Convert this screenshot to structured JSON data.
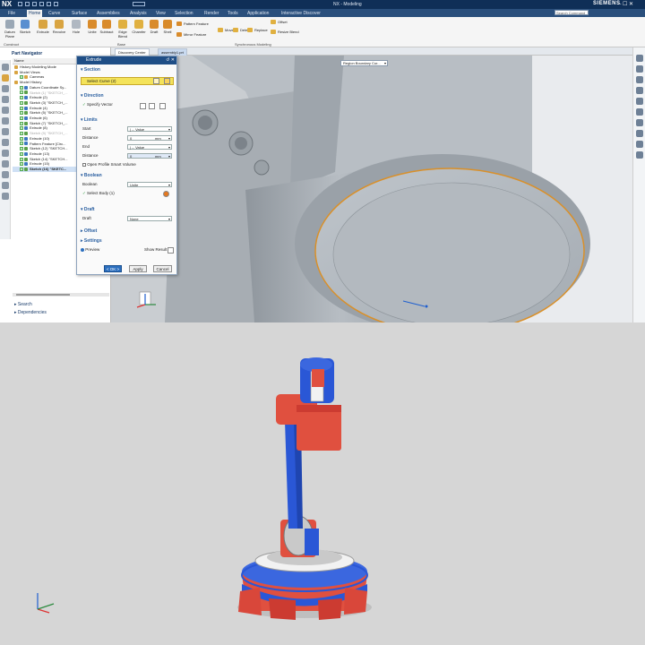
{
  "titlebar": {
    "app_logo": "NX",
    "window_title": "NX - Modeling",
    "brand": "SIEMENS",
    "controls": "– ☐ ✕"
  },
  "menu": {
    "tabs": [
      "File",
      "Home",
      "Curve",
      "Surface",
      "Assemblies",
      "Analysis",
      "View",
      "Selection",
      "Render",
      "Tools",
      "Application",
      "Interactive Discover"
    ],
    "active_index": 1,
    "search_placeholder": "Search Command"
  },
  "ribbon": {
    "buttons": [
      {
        "label": "Datum Plane",
        "icon": "datum-plane-icon",
        "color": "#9aa7b5"
      },
      {
        "label": "Sketch",
        "icon": "sketch-icon",
        "color": "#5a8fd0"
      },
      {
        "label": "Extrude",
        "icon": "extrude-icon",
        "color": "#d9a441"
      },
      {
        "label": "Revolve",
        "icon": "revolve-icon",
        "color": "#d9a441"
      },
      {
        "label": "Hole",
        "icon": "hole-icon",
        "color": "#b0b8c2"
      },
      {
        "label": "Unite",
        "icon": "unite-icon",
        "color": "#d98b2b"
      },
      {
        "label": "Subtract",
        "icon": "subtract-icon",
        "color": "#d98b2b"
      },
      {
        "label": "Edge Blend",
        "icon": "edge-blend-icon",
        "color": "#e0b040"
      },
      {
        "label": "Chamfer",
        "icon": "chamfer-icon",
        "color": "#e0b040"
      },
      {
        "label": "Draft",
        "icon": "draft-icon",
        "color": "#d98b2b"
      },
      {
        "label": "Shell",
        "icon": "shell-icon",
        "color": "#d98b2b"
      }
    ],
    "small_left": [
      {
        "label": "Pattern Feature",
        "icon": "pattern-feature-icon"
      },
      {
        "label": "Mirror Feature",
        "icon": "mirror-feature-icon"
      }
    ],
    "small_right": [
      {
        "label": "Move",
        "icon": "move-face-icon"
      },
      {
        "label": "Delete",
        "icon": "delete-face-icon"
      },
      {
        "label": "Replace",
        "icon": "replace-face-icon"
      },
      {
        "label": "Offset",
        "icon": "offset-face-icon"
      },
      {
        "label": "Resize Blend",
        "icon": "resize-blend-icon"
      }
    ],
    "groups": [
      "Construct",
      "Base",
      "Synchronous Modeling"
    ]
  },
  "docbar": {
    "tabs": [
      "Discovery Center",
      "assembly1.prt"
    ],
    "active_index": 1
  },
  "nav": {
    "title": "Part Navigator",
    "column": "Name",
    "tree": [
      {
        "label": "History Modeling Mode",
        "icon": "history-icon",
        "indent": 0,
        "state": "normal",
        "kind": "mode"
      },
      {
        "label": "Model Views",
        "icon": "folder-icon",
        "indent": 0,
        "state": "normal",
        "kind": "mode"
      },
      {
        "label": "Cameras",
        "icon": "camera-icon",
        "indent": 1,
        "state": "normal",
        "kind": "mode"
      },
      {
        "label": "Model History",
        "icon": "folder-icon",
        "indent": 0,
        "state": "normal",
        "kind": "mode"
      },
      {
        "label": "Datum Coordinate Sy...",
        "icon": "datum-csys-icon",
        "indent": 1,
        "state": "normal",
        "kind": "feature"
      },
      {
        "label": "Sketch (1) \"SKETCH_...",
        "icon": "sketch-icon",
        "indent": 1,
        "state": "dim",
        "kind": "sketch"
      },
      {
        "label": "Extrude (2)",
        "icon": "extrude-icon",
        "indent": 1,
        "state": "normal",
        "kind": "feature"
      },
      {
        "label": "Sketch (3) \"SKETCH_...",
        "icon": "sketch-icon",
        "indent": 1,
        "state": "normal",
        "kind": "sketch"
      },
      {
        "label": "Extrude (4)",
        "icon": "extrude-icon",
        "indent": 1,
        "state": "normal",
        "kind": "feature"
      },
      {
        "label": "Sketch (5) \"SKETCH_...",
        "icon": "sketch-icon",
        "indent": 1,
        "state": "normal",
        "kind": "sketch"
      },
      {
        "label": "Extrude (6)",
        "icon": "extrude-icon",
        "indent": 1,
        "state": "normal",
        "kind": "feature"
      },
      {
        "label": "Sketch (7) \"SKETCH_...",
        "icon": "sketch-icon",
        "indent": 1,
        "state": "normal",
        "kind": "sketch"
      },
      {
        "label": "Extrude (8)",
        "icon": "extrude-icon",
        "indent": 1,
        "state": "normal",
        "kind": "feature"
      },
      {
        "label": "Sketch (9) \"SKETCH_...",
        "icon": "sketch-icon",
        "indent": 1,
        "state": "dim",
        "kind": "sketch"
      },
      {
        "label": "Extrude (10)",
        "icon": "extrude-icon",
        "indent": 1,
        "state": "normal",
        "kind": "feature"
      },
      {
        "label": "Pattern Feature [Circ...",
        "icon": "pattern-feature-icon",
        "indent": 1,
        "state": "normal",
        "kind": "feature"
      },
      {
        "label": "Sketch (12) \"SKETCH...",
        "icon": "sketch-icon",
        "indent": 1,
        "state": "normal",
        "kind": "sketch"
      },
      {
        "label": "Extrude (13)",
        "icon": "extrude-icon",
        "indent": 1,
        "state": "normal",
        "kind": "feature"
      },
      {
        "label": "Sketch (14) \"SKETCH...",
        "icon": "sketch-icon",
        "indent": 1,
        "state": "normal",
        "kind": "sketch"
      },
      {
        "label": "Extrude (15)",
        "icon": "extrude-icon",
        "indent": 1,
        "state": "normal",
        "kind": "feature"
      },
      {
        "label": "Sketch (16) \"SKETC...",
        "icon": "sketch-icon",
        "indent": 1,
        "state": "selected",
        "kind": "sketch"
      }
    ],
    "footer": [
      "Search",
      "Dependencies"
    ]
  },
  "viewport": {
    "selection_filter": "Region Boundary Cur..."
  },
  "dialog": {
    "title": "Extrude",
    "sections": {
      "section": {
        "label": "Section",
        "select": "Select Curve (2)"
      },
      "direction": {
        "label": "Direction",
        "specify": "Specify Vector"
      },
      "limits": {
        "label": "Limits",
        "start_label": "Start",
        "start_value": "|→ Value",
        "distance_label": "Distance",
        "distance_start": "0",
        "end_label": "End",
        "end_value": "|→ Value",
        "distance_end": "0",
        "unit": "mm",
        "open_profile": "Open Profile Smart Volume"
      },
      "boolean": {
        "label": "Boolean",
        "boolean_label": "Boolean",
        "boolean_value": "Unite",
        "select_body": "Select Body (1)"
      },
      "draft": {
        "label": "Draft",
        "draft_label": "Draft",
        "draft_value": "None"
      },
      "offset": {
        "label": "Offset"
      },
      "settings": {
        "label": "Settings"
      }
    },
    "preview": "Preview",
    "show_result": "Show Result",
    "buttons": {
      "ok": "< OK >",
      "apply": "Apply",
      "cancel": "Cancel"
    }
  },
  "colors": {
    "accent": "#1f4e86",
    "select_yellow": "#f4e35a",
    "robot_blue": "#2a57d6",
    "robot_red": "#e0503f",
    "part_gray": "#aeb4ba"
  }
}
